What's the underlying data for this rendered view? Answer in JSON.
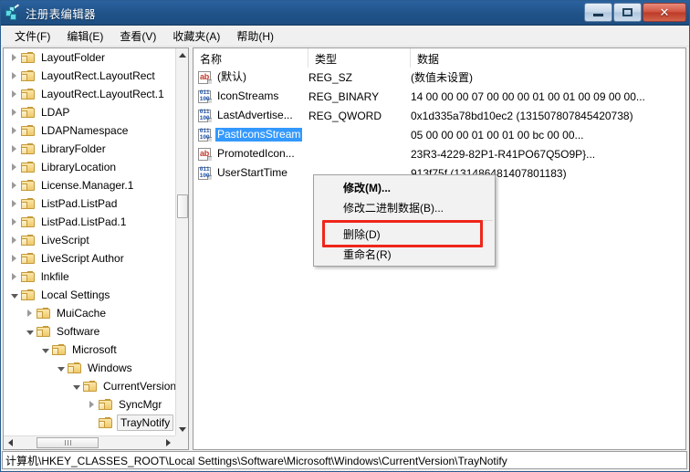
{
  "window": {
    "title": "注册表编辑器",
    "icon": "registry-icon",
    "controls": {
      "minimize": "最小化",
      "maximize": "最大化",
      "close": "✕"
    }
  },
  "menubar": {
    "items": [
      {
        "label": "文件(F)"
      },
      {
        "label": "编辑(E)"
      },
      {
        "label": "查看(V)"
      },
      {
        "label": "收藏夹(A)"
      },
      {
        "label": "帮助(H)"
      }
    ]
  },
  "tree": {
    "nodes": [
      {
        "label": "LayoutFolder",
        "indent": 0,
        "state": "collapsed",
        "selected": false
      },
      {
        "label": "LayoutRect.LayoutRect",
        "indent": 0,
        "state": "collapsed",
        "selected": false
      },
      {
        "label": "LayoutRect.LayoutRect.1",
        "indent": 0,
        "state": "collapsed",
        "selected": false
      },
      {
        "label": "LDAP",
        "indent": 0,
        "state": "collapsed",
        "selected": false
      },
      {
        "label": "LDAPNamespace",
        "indent": 0,
        "state": "collapsed",
        "selected": false
      },
      {
        "label": "LibraryFolder",
        "indent": 0,
        "state": "collapsed",
        "selected": false
      },
      {
        "label": "LibraryLocation",
        "indent": 0,
        "state": "collapsed",
        "selected": false
      },
      {
        "label": "License.Manager.1",
        "indent": 0,
        "state": "collapsed",
        "selected": false
      },
      {
        "label": "ListPad.ListPad",
        "indent": 0,
        "state": "collapsed",
        "selected": false
      },
      {
        "label": "ListPad.ListPad.1",
        "indent": 0,
        "state": "collapsed",
        "selected": false
      },
      {
        "label": "LiveScript",
        "indent": 0,
        "state": "collapsed",
        "selected": false
      },
      {
        "label": "LiveScript Author",
        "indent": 0,
        "state": "collapsed",
        "selected": false
      },
      {
        "label": "lnkfile",
        "indent": 0,
        "state": "collapsed",
        "selected": false
      },
      {
        "label": "Local Settings",
        "indent": 0,
        "state": "expanded",
        "selected": false
      },
      {
        "label": "MuiCache",
        "indent": 1,
        "state": "collapsed",
        "selected": false
      },
      {
        "label": "Software",
        "indent": 1,
        "state": "expanded",
        "selected": false
      },
      {
        "label": "Microsoft",
        "indent": 2,
        "state": "expanded",
        "selected": false
      },
      {
        "label": "Windows",
        "indent": 3,
        "state": "expanded",
        "selected": false
      },
      {
        "label": "CurrentVersion",
        "indent": 4,
        "state": "expanded",
        "selected": false
      },
      {
        "label": "SyncMgr",
        "indent": 5,
        "state": "collapsed",
        "selected": false
      },
      {
        "label": "TrayNotify",
        "indent": 5,
        "state": "leaf",
        "selected": true
      }
    ]
  },
  "list": {
    "columns": [
      "名称",
      "类型",
      "数据"
    ],
    "rows": [
      {
        "icon": "string-value-icon",
        "name": "(默认)",
        "type": "REG_SZ",
        "data": "(数值未设置)",
        "selected": false
      },
      {
        "icon": "binary-value-icon",
        "name": "IconStreams",
        "type": "REG_BINARY",
        "data": "14 00 00 00 07 00 00 00 01 00 01 00 09 00 00...",
        "selected": false
      },
      {
        "icon": "binary-value-icon",
        "name": "LastAdvertise...",
        "type": "REG_QWORD",
        "data": "0x1d335a78bd10ec2 (131507807845420738)",
        "selected": false
      },
      {
        "icon": "binary-value-icon",
        "name": "PastIconsStream",
        "type": "",
        "data": "05 00 00 00 01 00 01 00 bc 00 00...",
        "selected": true
      },
      {
        "icon": "string-value-icon",
        "name": "PromotedIcon...",
        "type": "",
        "data": "23R3-4229-82P1-R41PO67Q5O9P}...",
        "selected": false
      },
      {
        "icon": "binary-value-icon",
        "name": "UserStartTime",
        "type": "",
        "data": "913f75f (131486481407801183)",
        "selected": false
      }
    ]
  },
  "context_menu": {
    "items": [
      {
        "label": "修改(M)...",
        "bold": true,
        "separator_after": false
      },
      {
        "label": "修改二进制数据(B)...",
        "bold": false,
        "separator_after": true
      },
      {
        "label": "删除(D)",
        "bold": false,
        "separator_after": false,
        "highlighted": true
      },
      {
        "label": "重命名(R)",
        "bold": false,
        "separator_after": false
      }
    ],
    "highlight_color": "#f0261b"
  },
  "statusbar": {
    "path": "计算机\\HKEY_CLASSES_ROOT\\Local Settings\\Software\\Microsoft\\Windows\\CurrentVersion\\TrayNotify"
  },
  "icon_glyphs": {
    "string": "ab",
    "binary_top": "011",
    "binary_bottom": "100"
  }
}
